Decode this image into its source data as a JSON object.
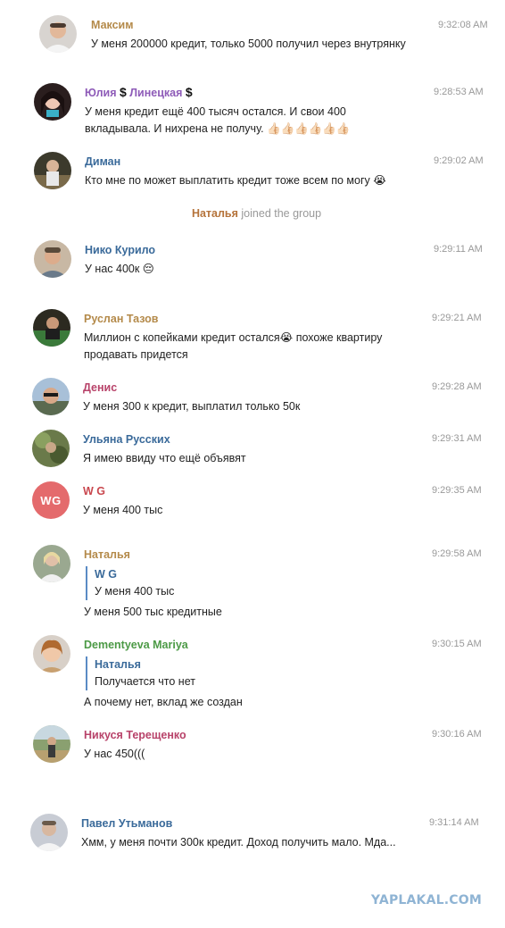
{
  "messages": [
    {
      "name": "Максим",
      "time": "9:32:08 AM",
      "text": "У меня 200000 кредит, только 5000 получил через внутрянку",
      "name_color": "#b48a4a",
      "avatar": "photo"
    },
    {
      "name": "Юлия",
      "name_suffix": "Линецкая",
      "time": "9:28:53 AM",
      "text": "У меня кредит ещё 400 тысяч остался. И свои 400 вкладывала. И нихрена не получу. 👍🏻👍🏻👍🏻👍🏻👍🏻👍🏻",
      "name_color": "#8e5bb8"
    },
    {
      "name": "Диман",
      "time": "9:29:02 AM",
      "text": "Кто мне по может выплатить кредит тоже всем по могу 😭",
      "name_color": "#3a6a9a"
    },
    {
      "name": "Нико Курило",
      "time": "9:29:11 AM",
      "text": "У нас 400к 😔",
      "name_color": "#3a6a9a"
    },
    {
      "name": "Руслан Тазов",
      "time": "9:29:21 AM",
      "text": "Миллион с копейками кредит остался😭 похоже квартиру продавать придется",
      "name_color": "#b48a4a"
    },
    {
      "name": "Денис",
      "time": "9:29:28 AM",
      "text": "У меня 300 к кредит, выплатил только 50к",
      "name_color": "#b8436a"
    },
    {
      "name": "Ульяна Русских",
      "time": "9:29:31 AM",
      "text": "Я имею ввиду что ещё объявят",
      "name_color": "#3a6a9a"
    },
    {
      "name": "W G",
      "time": "9:29:35 AM",
      "text": "У меня 400 тыс",
      "name_color": "#c9484f",
      "initials": "WG",
      "avatar_color": "#e46a6c"
    },
    {
      "name": "Наталья",
      "time": "9:29:58 AM",
      "text": "У меня 500 тыс кредитные",
      "name_color": "#b48a4a",
      "reply_name": "W G",
      "reply_text": "У меня 400 тыс"
    },
    {
      "name": "Dementyeva Mariya",
      "time": "9:30:15 AM",
      "text": "А почему нет, вклад же создан",
      "name_color": "#4c9a46",
      "reply_name": "Наталья",
      "reply_text": "Получается что нет"
    },
    {
      "name": "Никуся Терещенко",
      "time": "9:30:16 AM",
      "text": "У нас 450(((",
      "name_color": "#b8436a"
    },
    {
      "name": "Павел Утьманов",
      "time": "9:31:14 AM",
      "text": "Хмм, у меня почти 300к кредит. Доход получить мало. Мда...",
      "name_color": "#3a6a9a"
    }
  ],
  "service": {
    "name": "Наталья",
    "action": "joined the group"
  },
  "dollar": "$",
  "watermark": "YAPLAKAL.COM"
}
